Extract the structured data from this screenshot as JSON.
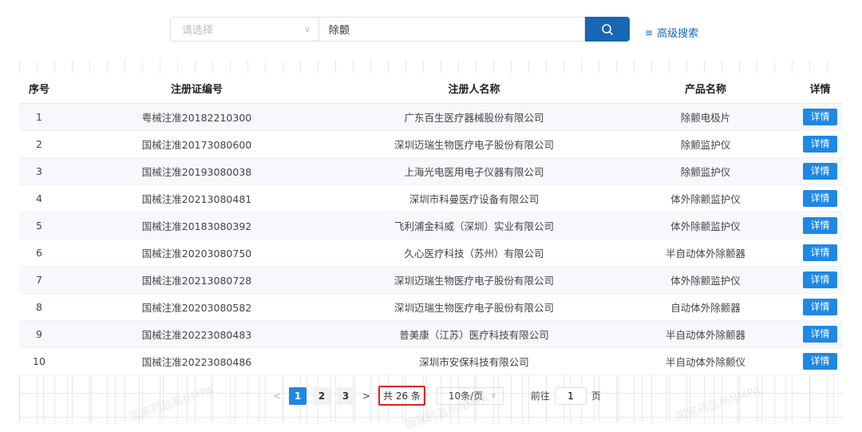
{
  "search": {
    "select_placeholder": "请选择",
    "query": "除颤",
    "advanced_label": "高级搜索"
  },
  "table": {
    "columns": [
      "序号",
      "注册证编号",
      "注册人名称",
      "产品名称",
      "详情"
    ],
    "detail_label": "详情",
    "rows": [
      {
        "idx": "1",
        "reg_no": "粤械注准20182210300",
        "registrant": "广东百生医疗器械股份有限公司",
        "product": "除颤电极片"
      },
      {
        "idx": "2",
        "reg_no": "国械注准20173080600",
        "registrant": "深圳迈瑞生物医疗电子股份有限公司",
        "product": "除颤监护仪"
      },
      {
        "idx": "3",
        "reg_no": "国械注准20193080038",
        "registrant": "上海光电医用电子仪器有限公司",
        "product": "除颤监护仪"
      },
      {
        "idx": "4",
        "reg_no": "国械注准20213080481",
        "registrant": "深圳市科曼医疗设备有限公司",
        "product": "体外除颤监护仪"
      },
      {
        "idx": "5",
        "reg_no": "国械注准20183080392",
        "registrant": "飞利浦金科威（深圳）实业有限公司",
        "product": "体外除颤监护仪"
      },
      {
        "idx": "6",
        "reg_no": "国械注准20203080750",
        "registrant": "久心医疗科技（苏州）有限公司",
        "product": "半自动体外除颤器"
      },
      {
        "idx": "7",
        "reg_no": "国械注准20213080728",
        "registrant": "深圳迈瑞生物医疗电子股份有限公司",
        "product": "体外除颤监护仪"
      },
      {
        "idx": "8",
        "reg_no": "国械注准20203080582",
        "registrant": "深圳迈瑞生物医疗电子股份有限公司",
        "product": "自动体外除颤器"
      },
      {
        "idx": "9",
        "reg_no": "国械注准20223080483",
        "registrant": "普美康（江苏）医疗科技有限公司",
        "product": "半自动体外除颤器"
      },
      {
        "idx": "10",
        "reg_no": "国械注准20223080486",
        "registrant": "深圳市安保科技有限公司",
        "product": "半自动体外除颤仪"
      }
    ]
  },
  "pagination": {
    "pages": [
      "1",
      "2",
      "3"
    ],
    "current_page": "1",
    "total": "共 26 条",
    "page_size": "10条/页",
    "goto_label": "前往",
    "goto_value": "1",
    "page_unit": "页"
  },
  "watermark": "国家药监局NMPA",
  "colors": {
    "primary": "#1767b5",
    "button": "#1e88e5",
    "highlight_box": "#e0211f"
  }
}
